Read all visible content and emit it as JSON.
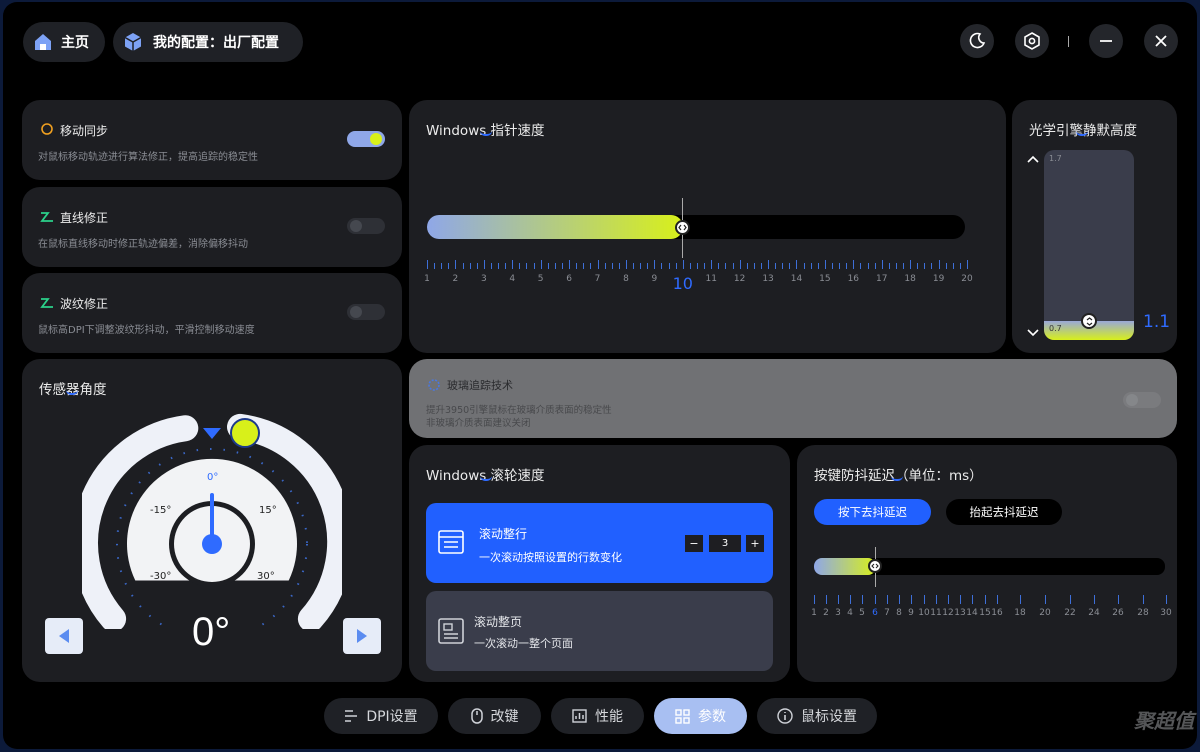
{
  "header": {
    "home_label": "主页",
    "config_label": "我的配置：出厂配置"
  },
  "toggles": [
    {
      "title": "移动同步",
      "desc": "对鼠标移动轨迹进行算法修正，提高追踪的稳定性",
      "on": true
    },
    {
      "title": "直线修正",
      "desc": "在鼠标直线移动时修正轨迹偏差，消除偏移抖动",
      "on": false
    },
    {
      "title": "波纹修正",
      "desc": "鼠标高DPI下调整波纹形抖动，平滑控制移动速度",
      "on": false
    }
  ],
  "pointer_speed": {
    "title": "Windows 指针速度",
    "value": "10",
    "min": 1,
    "max": 20,
    "ticks": [
      "1",
      "2",
      "3",
      "4",
      "5",
      "6",
      "7",
      "8",
      "9",
      "10",
      "11",
      "12",
      "13",
      "14",
      "15",
      "16",
      "17",
      "18",
      "19",
      "20"
    ]
  },
  "lod": {
    "title": "光学引擎静默高度",
    "max_label": "1.7",
    "min_label": "0.7",
    "value": "1.1"
  },
  "sensor_angle": {
    "title": "传感器角度",
    "value": "0°",
    "labels": {
      "center": "0°",
      "neg15": "-15°",
      "pos15": "15°",
      "neg30": "-30°",
      "pos30": "30°"
    }
  },
  "glass": {
    "title": "玻璃追踪技术",
    "desc1": "提升3950引擎鼠标在玻璃介质表面的稳定性",
    "desc2": "非玻璃介质表面建议关闭",
    "on": false
  },
  "scroll": {
    "title": "Windows 滚轮速度",
    "option1_title": "滚动整行",
    "option1_desc": "一次滚动按照设置的行数变化",
    "lines_value": "3",
    "minus": "−",
    "plus": "+",
    "option2_title": "滚动整页",
    "option2_desc": "一次滚动一整个页面"
  },
  "debounce": {
    "title": "按键防抖延迟（单位：ms）",
    "tab_press": "按下去抖延迟",
    "tab_release": "抬起去抖延迟",
    "value": 6,
    "ticks": [
      "1",
      "2",
      "3",
      "4",
      "5",
      "6",
      "7",
      "8",
      "9",
      "10",
      "11",
      "12",
      "13",
      "14",
      "15",
      "16",
      "18",
      "20",
      "22",
      "24",
      "26",
      "28",
      "30"
    ]
  },
  "bottom_nav": [
    {
      "label": "DPI设置",
      "icon": "dpi-icon"
    },
    {
      "label": "改键",
      "icon": "mouse-icon"
    },
    {
      "label": "性能",
      "icon": "chart-icon"
    },
    {
      "label": "参数",
      "icon": "grid-icon",
      "active": true
    },
    {
      "label": "鼠标设置",
      "icon": "info-icon"
    }
  ],
  "watermark": "聚超值",
  "colors": {
    "accent": "#2f6bff",
    "lime": "#d8f01a",
    "panel": "#1d1e22"
  }
}
